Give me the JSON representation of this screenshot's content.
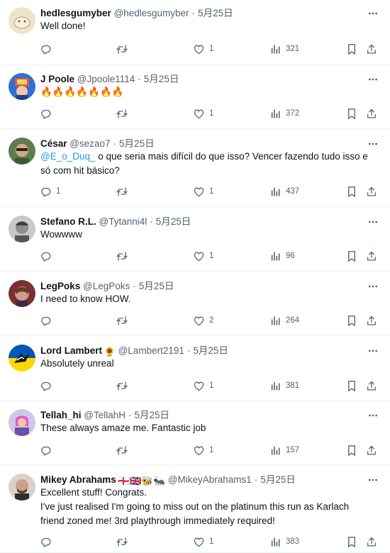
{
  "tweets": [
    {
      "name": "hedlesgumyber",
      "handle": "@hedlesgumyber",
      "date": "5月25日",
      "text": "Well done!",
      "replies": "",
      "likes": "1",
      "views": "321",
      "avatar": "cream"
    },
    {
      "name": "J Poole",
      "handle": "@Jpoole1114",
      "date": "5月25日",
      "text": "🔥🔥🔥🔥🔥🔥🔥",
      "replies": "",
      "likes": "1",
      "views": "372",
      "avatar": "blue"
    },
    {
      "name": "César",
      "handle": "@sezao7",
      "date": "5月25日",
      "mention": "@E_o_Duq_",
      "text": " o que seria mais difícil do que isso? Vencer fazendo tudo isso e só com hit básico?",
      "replies": "1",
      "likes": "1",
      "views": "437",
      "avatar": "green"
    },
    {
      "name": "Stefano R.L.",
      "handle": "@Tytanni4l",
      "date": "5月25日",
      "text": "Wowwww",
      "replies": "",
      "likes": "1",
      "views": "96",
      "avatar": "gray"
    },
    {
      "name": "LegPoks",
      "handle": "@LegPoks",
      "date": "5月25日",
      "text": "I need to know HOW.",
      "replies": "",
      "likes": "2",
      "views": "264",
      "avatar": "maroon"
    },
    {
      "name": "Lord Lambert",
      "emoji": "🌻",
      "handle": "@Lambert2191",
      "date": "5月25日",
      "text": "Absolutely unreal",
      "replies": "",
      "likes": "1",
      "views": "381",
      "avatar": "flag"
    },
    {
      "name": "Tellah_hi",
      "handle": "@TellahH",
      "date": "5月25日",
      "text": "These always amaze me. Fantastic job",
      "replies": "",
      "likes": "1",
      "views": "157",
      "avatar": "pink"
    },
    {
      "name": "Mikey Abrahams",
      "emoji": "🏴󠁧󠁢󠁥󠁮󠁧󠁿🇬🇧🐝🐜",
      "handle": "@MikeyAbrahams1",
      "date": "5月25日",
      "text": "Excellent stuff! Congrats.\nI've just realised I'm going to miss out on the platinum this run as Karlach friend zoned me! 3rd playthrough immediately required!",
      "replies": "",
      "likes": "1",
      "views": "383",
      "avatar": "bald"
    }
  ],
  "separator": "·",
  "icons": {
    "reply": "reply-icon",
    "retweet": "retweet-icon",
    "like": "heart-icon",
    "views": "views-icon",
    "bookmark": "bookmark-icon",
    "share": "share-icon",
    "more": "more-icon"
  },
  "colors": {
    "text": "#0f1419",
    "secondary": "#536471",
    "link": "#1d9bf0",
    "divider": "#eff3f4"
  }
}
